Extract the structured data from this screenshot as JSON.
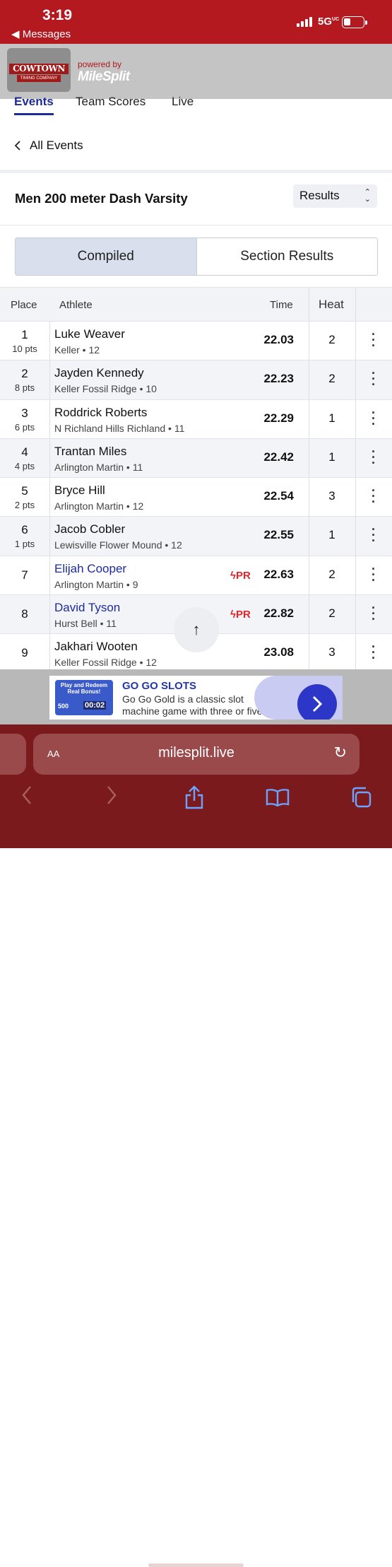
{
  "status": {
    "time": "3:19",
    "back_label": "◀ Messages",
    "network": "5G",
    "network_sup": "UC"
  },
  "banner": {
    "logo_line1": "COWTOWN",
    "logo_line2": "TIMING COMPANY",
    "powered_by": "powered by",
    "brand": "MileSplit"
  },
  "tabs": [
    {
      "label": "Events"
    },
    {
      "label": "Team Scores"
    },
    {
      "label": "Live"
    }
  ],
  "nav": {
    "all_events": "All Events"
  },
  "event": {
    "title": "Men 200 meter Dash Varsity",
    "view_select": "Results"
  },
  "toggle": {
    "compiled": "Compiled",
    "section": "Section Results"
  },
  "table": {
    "headers": {
      "place": "Place",
      "athlete": "Athlete",
      "time": "Time",
      "heat": "Heat"
    },
    "rows": [
      {
        "place": "1",
        "pts": "10 pts",
        "name": "Luke Weaver",
        "school": "Keller • 12",
        "pr": "",
        "time": "22.03",
        "heat": "2"
      },
      {
        "place": "2",
        "pts": "8 pts",
        "name": "Jayden Kennedy",
        "school": "Keller Fossil Ridge • 10",
        "pr": "",
        "time": "22.23",
        "heat": "2"
      },
      {
        "place": "3",
        "pts": "6 pts",
        "name": "Roddrick Roberts",
        "school": "N Richland Hills Richland • 11",
        "pr": "",
        "time": "22.29",
        "heat": "1"
      },
      {
        "place": "4",
        "pts": "4 pts",
        "name": "Trantan Miles",
        "school": "Arlington Martin • 11",
        "pr": "",
        "time": "22.42",
        "heat": "1"
      },
      {
        "place": "5",
        "pts": "2 pts",
        "name": "Bryce Hill",
        "school": "Arlington Martin • 12",
        "pr": "",
        "time": "22.54",
        "heat": "3"
      },
      {
        "place": "6",
        "pts": "1 pts",
        "name": "Jacob Cobler",
        "school": "Lewisville Flower Mound • 12",
        "pr": "",
        "time": "22.55",
        "heat": "1"
      },
      {
        "place": "7",
        "pts": "",
        "name": "Elijah Cooper",
        "school": "Arlington Martin • 9",
        "pr": "PR",
        "time": "22.63",
        "heat": "2"
      },
      {
        "place": "8",
        "pts": "",
        "name": "David Tyson",
        "school": "Hurst Bell • 11",
        "pr": "PR",
        "time": "22.82",
        "heat": "2"
      },
      {
        "place": "9",
        "pts": "",
        "name": "Jakhari Wooten",
        "school": "Keller Fossil Ridge • 12",
        "pr": "",
        "time": "23.08",
        "heat": "3"
      }
    ]
  },
  "ad": {
    "thumb_line1": "Play and Redeem",
    "thumb_line2": "Real Bonus!",
    "thumb_amount": "500",
    "thumb_timer": "00:02",
    "title": "GO GO SLOTS",
    "text": "Go Go Gold is a classic slot machine game with three or five"
  },
  "browser": {
    "text_size": "AA",
    "url": "milesplit.live"
  },
  "colors": {
    "brand_red": "#b3191f",
    "link_blue": "#1d2a9b",
    "pr_red": "#e0262b",
    "browser_bg": "#7a1a1c"
  }
}
